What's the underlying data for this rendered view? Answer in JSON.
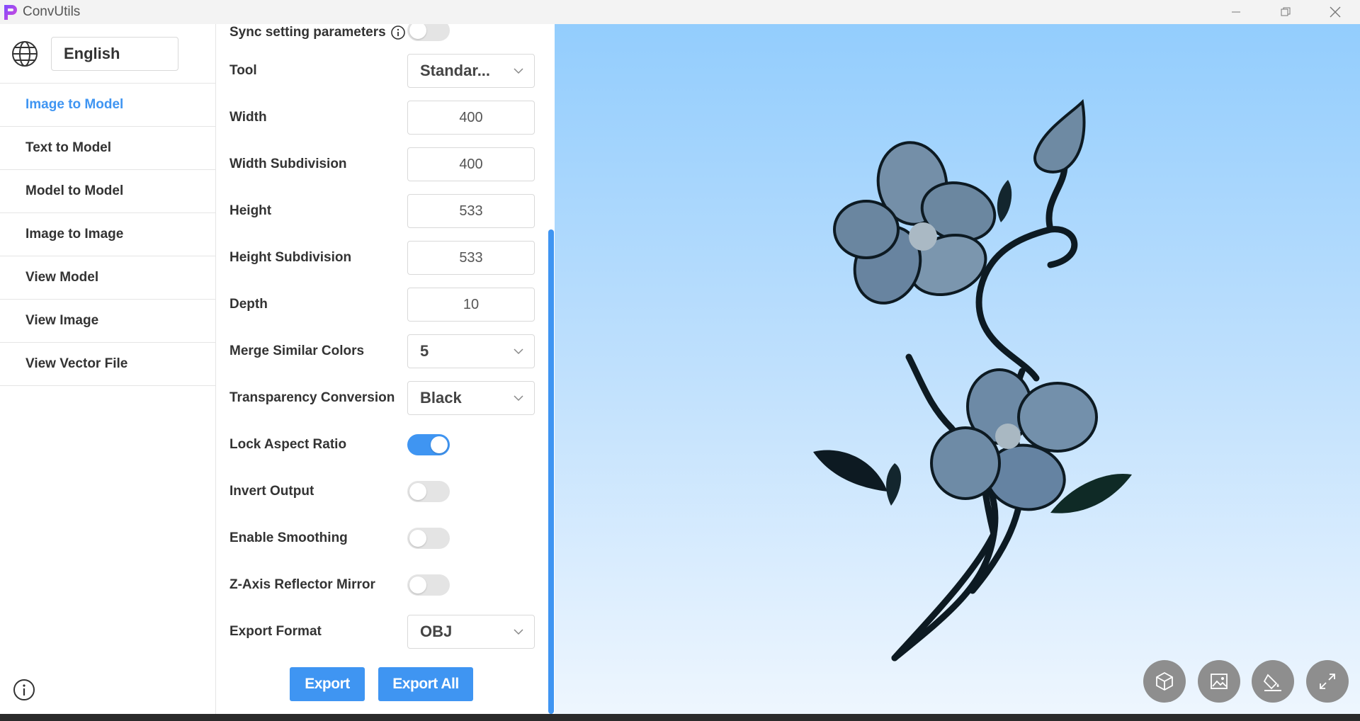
{
  "app": {
    "title": "ConvUtils"
  },
  "sidebar": {
    "language": "English",
    "items": [
      {
        "label": "Image to Model",
        "active": true
      },
      {
        "label": "Text to Model"
      },
      {
        "label": "Model to Model"
      },
      {
        "label": "Image to Image"
      },
      {
        "label": "View Model"
      },
      {
        "label": "View Image"
      },
      {
        "label": "View Vector File"
      }
    ]
  },
  "settings": {
    "sync_label": "Sync setting parameters",
    "tool": {
      "label": "Tool",
      "value": "Standar..."
    },
    "width": {
      "label": "Width",
      "value": "400"
    },
    "width_subdivision": {
      "label": "Width Subdivision",
      "value": "400"
    },
    "height": {
      "label": "Height",
      "value": "533"
    },
    "height_subdivision": {
      "label": "Height Subdivision",
      "value": "533"
    },
    "depth": {
      "label": "Depth",
      "value": "10"
    },
    "merge_similar_colors": {
      "label": "Merge Similar Colors",
      "value": "5"
    },
    "transparency_conversion": {
      "label": "Transparency Conversion",
      "value": "Black"
    },
    "lock_aspect_ratio": {
      "label": "Lock Aspect Ratio",
      "on": true
    },
    "invert_output": {
      "label": "Invert Output",
      "on": false
    },
    "enable_smoothing": {
      "label": "Enable Smoothing",
      "on": false
    },
    "z_axis_mirror": {
      "label": "Z-Axis Reflector Mirror",
      "on": false
    },
    "export_format": {
      "label": "Export Format",
      "value": "OBJ"
    },
    "export_label": "Export",
    "export_all_label": "Export All"
  },
  "preview": {
    "tools": [
      "model-icon",
      "image-icon",
      "paint-bucket-icon",
      "fullscreen-icon"
    ]
  },
  "colors": {
    "accent": "#3f95f2",
    "tool_button": "#8e8e8e"
  }
}
